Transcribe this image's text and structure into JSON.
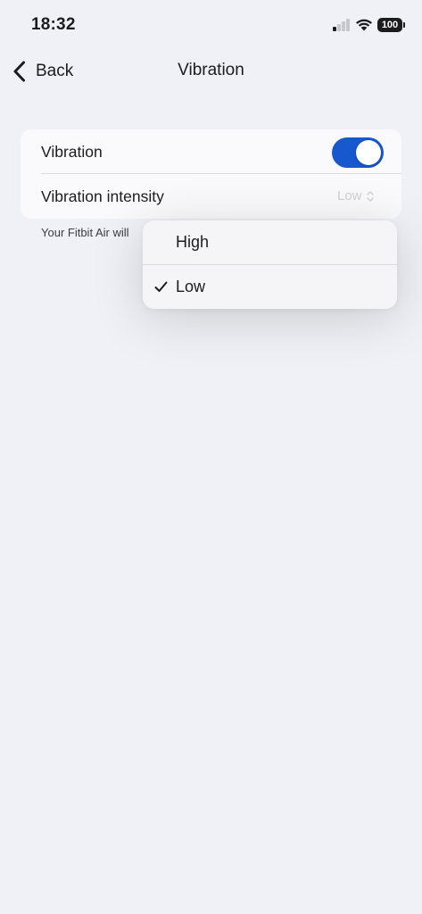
{
  "status_bar": {
    "time": "18:32",
    "battery": "100",
    "signal_bars_active": 1,
    "signal_bars_total": 4
  },
  "nav": {
    "back_label": "Back",
    "title": "Vibration"
  },
  "settings": {
    "vibration_label": "Vibration",
    "vibration_enabled": true,
    "intensity_label": "Vibration intensity",
    "intensity_value": "Low"
  },
  "footer_note": "Your Fitbit Air will",
  "menu": {
    "options": [
      {
        "label": "High",
        "selected": false
      },
      {
        "label": "Low",
        "selected": true
      }
    ]
  },
  "colors": {
    "accent": "#1758cf",
    "background": "#f0f1f6",
    "card": "#fafafc"
  },
  "icons": {
    "back": "chevron-left-icon",
    "wifi": "wifi-icon",
    "signal": "cellular-signal-icon",
    "battery": "battery-icon",
    "intensity": "chevron-up-down-icon",
    "selected": "checkmark-icon"
  }
}
